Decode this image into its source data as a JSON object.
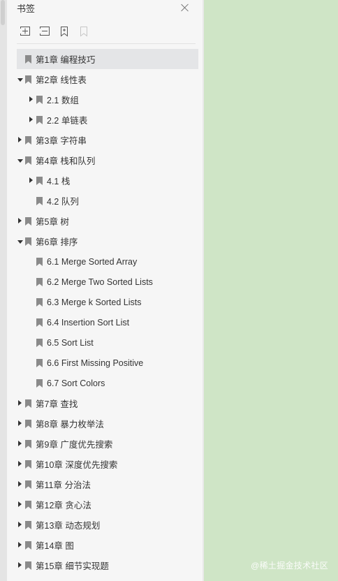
{
  "panel": {
    "title": "书签"
  },
  "watermark": "@稀土掘金技术社区",
  "toolbar": [
    {
      "name": "add-bookmark-icon"
    },
    {
      "name": "remove-bookmark-icon"
    },
    {
      "name": "bookmark-page-icon"
    },
    {
      "name": "bookmark-disabled-icon"
    }
  ],
  "bookmarks": [
    {
      "label": "第1章  编程技巧",
      "level": 0,
      "expander": "none",
      "selected": true
    },
    {
      "label": "第2章  线性表",
      "level": 0,
      "expander": "down"
    },
    {
      "label": "2.1 数组",
      "level": 1,
      "expander": "right"
    },
    {
      "label": "2.2 单链表",
      "level": 1,
      "expander": "right"
    },
    {
      "label": "第3章  字符串",
      "level": 0,
      "expander": "right"
    },
    {
      "label": "第4章  栈和队列",
      "level": 0,
      "expander": "down"
    },
    {
      "label": "4.1 栈",
      "level": 1,
      "expander": "right"
    },
    {
      "label": "4.2 队列",
      "level": 1,
      "expander": "none"
    },
    {
      "label": "第5章  树",
      "level": 0,
      "expander": "right"
    },
    {
      "label": "第6章  排序",
      "level": 0,
      "expander": "down"
    },
    {
      "label": "6.1 Merge Sorted Array",
      "level": 1,
      "expander": "none"
    },
    {
      "label": "6.2 Merge Two Sorted Lists",
      "level": 1,
      "expander": "none"
    },
    {
      "label": "6.3 Merge k Sorted Lists",
      "level": 1,
      "expander": "none"
    },
    {
      "label": "6.4 Insertion Sort List",
      "level": 1,
      "expander": "none"
    },
    {
      "label": "6.5 Sort List",
      "level": 1,
      "expander": "none"
    },
    {
      "label": "6.6 First Missing Positive",
      "level": 1,
      "expander": "none"
    },
    {
      "label": "6.7 Sort Colors",
      "level": 1,
      "expander": "none"
    },
    {
      "label": "第7章  查找",
      "level": 0,
      "expander": "right"
    },
    {
      "label": "第8章  暴力枚举法",
      "level": 0,
      "expander": "right"
    },
    {
      "label": "第9章  广度优先搜索",
      "level": 0,
      "expander": "right"
    },
    {
      "label": "第10章  深度优先搜索",
      "level": 0,
      "expander": "right"
    },
    {
      "label": "第11章  分治法",
      "level": 0,
      "expander": "right"
    },
    {
      "label": "第12章  贪心法",
      "level": 0,
      "expander": "right"
    },
    {
      "label": "第13章  动态规划",
      "level": 0,
      "expander": "right"
    },
    {
      "label": "第14章  图",
      "level": 0,
      "expander": "right"
    },
    {
      "label": "第15章  细节实现题",
      "level": 0,
      "expander": "right"
    }
  ]
}
